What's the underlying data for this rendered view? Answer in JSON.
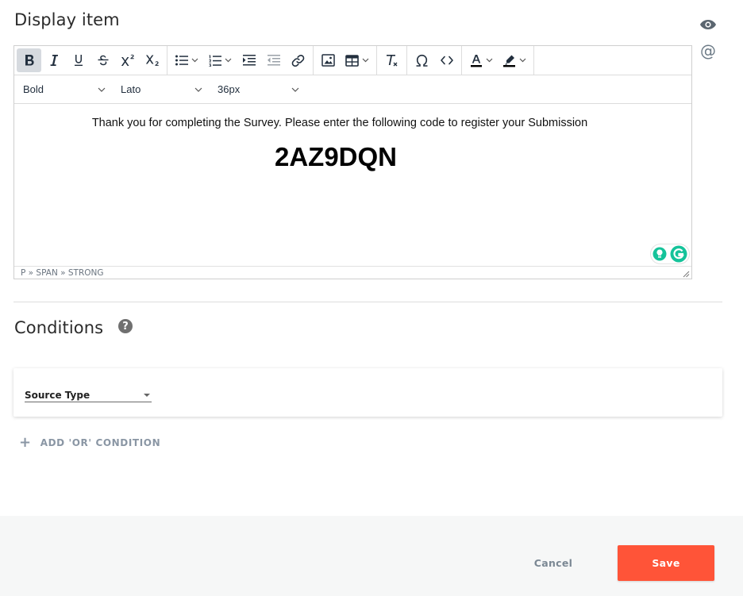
{
  "display_item": {
    "title": "Display item",
    "side_icons": [
      "eye-icon",
      "at-icon"
    ],
    "at_symbol": "@"
  },
  "editor": {
    "toolbar": {
      "groups": [
        [
          "bold-icon",
          "italic-icon",
          "underline-icon",
          "strikethrough-icon",
          "superscript-icon",
          "subscript-icon"
        ],
        [
          "bullet-list-icon",
          "numbered-list-icon",
          "indent-icon",
          "outdent-icon",
          "link-icon"
        ],
        [
          "image-icon",
          "table-icon"
        ],
        [
          "clear-format-icon"
        ],
        [
          "special-char-icon",
          "source-code-icon"
        ],
        [
          "text-color-icon",
          "highlight-color-icon"
        ]
      ],
      "active": "bold-icon"
    },
    "format_select": "Bold",
    "font_family_select": "Lato",
    "font_size_select": "36px",
    "body_text": "Thank you for completing the Survey. Please enter the following code to register your Submission",
    "code": "2AZ9DQN",
    "status_path": "P » SPAN » STRONG"
  },
  "conditions": {
    "title": "Conditions",
    "help_symbol": "?",
    "source_type_label": "Source Type",
    "add_or_label": "ADD 'OR' CONDITION"
  },
  "footer": {
    "cancel_label": "Cancel",
    "save_label": "Save"
  },
  "colors": {
    "accent": "#ff5438",
    "muted_text": "#8a96a4",
    "toolbar_active": "#d6dadf"
  }
}
